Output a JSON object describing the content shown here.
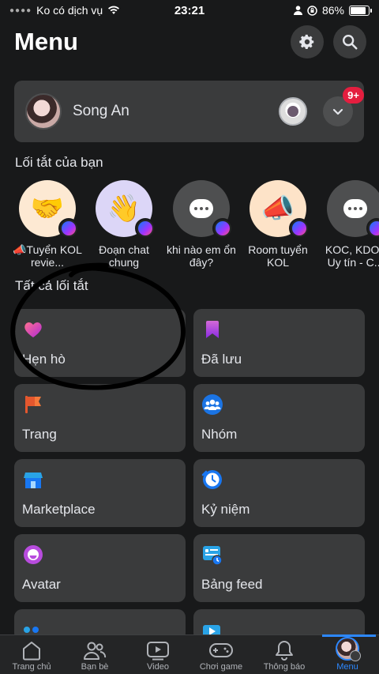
{
  "status_bar": {
    "carrier": "Ko có dịch vụ",
    "time": "23:21",
    "battery": "86%",
    "battery_level": 0.86
  },
  "header": {
    "title": "Menu",
    "settings_icon": "gear-icon",
    "search_icon": "search-icon"
  },
  "profile": {
    "name": "Song An",
    "notification_badge": "9+"
  },
  "shortcuts": {
    "title": "Lối tắt của bạn",
    "items": [
      {
        "label": "📣Tuyển KOL revie...",
        "icon": "handshake",
        "bg": "#fde9d3"
      },
      {
        "label": "Đoạn chat chung",
        "icon": "waving-hand",
        "bg": "#dcd6f7"
      },
      {
        "label": "khi nào em ổn đây?",
        "icon": "chat-bubble",
        "bg": "#4e4f50"
      },
      {
        "label": "Room tuyển KOL",
        "icon": "megaphone",
        "bg": "#fde3c8"
      },
      {
        "label": "KOC, KDOL Uy tín - C...",
        "icon": "chat-bubble",
        "bg": "#4e4f50"
      }
    ]
  },
  "all_shortcuts": {
    "title": "Tất cả lối tắt",
    "tiles": [
      {
        "label": "Hẹn hò",
        "icon": "heart-icon"
      },
      {
        "label": "Đã lưu",
        "icon": "bookmark-icon"
      },
      {
        "label": "Trang",
        "icon": "flag-icon"
      },
      {
        "label": "Nhóm",
        "icon": "groups-icon"
      },
      {
        "label": "Marketplace",
        "icon": "store-icon"
      },
      {
        "label": "Kỷ niệm",
        "icon": "clock-icon"
      },
      {
        "label": "Avatar",
        "icon": "avatar-icon"
      },
      {
        "label": "Bảng feed",
        "icon": "feed-icon"
      }
    ]
  },
  "tabbar": {
    "tabs": [
      {
        "label": "Trang chủ",
        "icon": "home-icon"
      },
      {
        "label": "Bạn bè",
        "icon": "friends-icon"
      },
      {
        "label": "Video",
        "icon": "video-icon"
      },
      {
        "label": "Chơi game",
        "icon": "gamepad-icon"
      },
      {
        "label": "Thông báo",
        "icon": "bell-icon"
      },
      {
        "label": "Menu",
        "icon": "profile-avatar",
        "active": true
      }
    ]
  },
  "colors": {
    "background": "#18191a",
    "card": "#3a3b3c",
    "accent": "#2d88ff",
    "badge": "#e41e3f"
  }
}
